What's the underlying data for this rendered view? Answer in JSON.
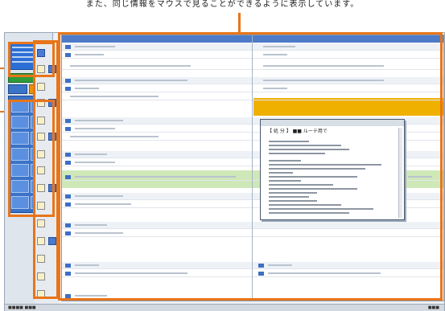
{
  "caption": "また、同じ情報をマウスで見ることができるように表示しています。",
  "popup": {
    "title": "【 処 分 】 ■■ ルーテ用で"
  },
  "status": {
    "left": "■■■■ ■■■",
    "right": "■■■"
  }
}
